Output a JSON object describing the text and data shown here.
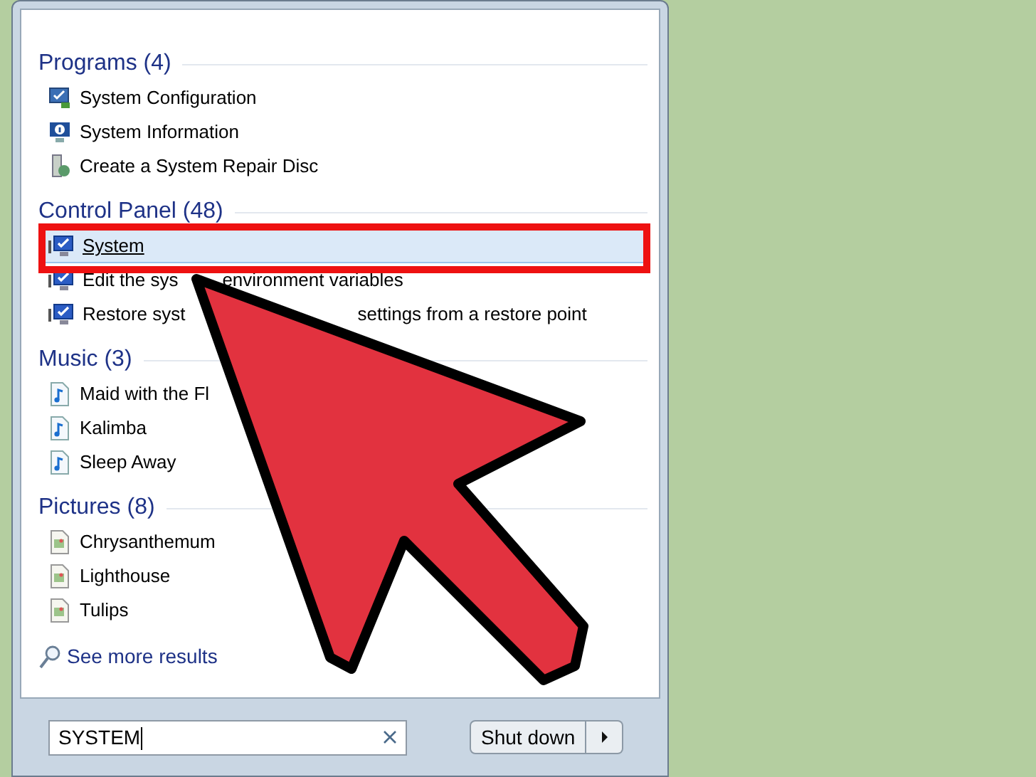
{
  "groups": [
    {
      "heading": "Programs (4)",
      "items": [
        {
          "kind": "config",
          "parts": [
            "System Configuration"
          ],
          "selected": false
        },
        {
          "kind": "info",
          "parts": [
            "System Information"
          ],
          "selected": false
        },
        {
          "kind": "repair",
          "parts": [
            "Create a System Repair Disc"
          ],
          "selected": false
        }
      ]
    },
    {
      "heading": "Control Panel (48)",
      "items": [
        {
          "kind": "control",
          "parts": [
            "System"
          ],
          "selected": true
        },
        {
          "kind": "control",
          "parts": [
            "Edit the sys",
            "environment variables"
          ],
          "selected": false
        },
        {
          "kind": "control",
          "parts": [
            "Restore syst",
            "settings from a restore point"
          ],
          "selected": false
        }
      ]
    },
    {
      "heading": "Music (3)",
      "items": [
        {
          "kind": "music",
          "parts": [
            "Maid with the Fl"
          ],
          "selected": false
        },
        {
          "kind": "music",
          "parts": [
            "Kalimba"
          ],
          "selected": false
        },
        {
          "kind": "music",
          "parts": [
            "Sleep Away"
          ],
          "selected": false
        }
      ]
    },
    {
      "heading": "Pictures (8)",
      "items": [
        {
          "kind": "picture",
          "parts": [
            "Chrysanthemum"
          ],
          "selected": false
        },
        {
          "kind": "picture",
          "parts": [
            "Lighthouse"
          ],
          "selected": false
        },
        {
          "kind": "picture",
          "parts": [
            "Tulips"
          ],
          "selected": false
        }
      ]
    }
  ],
  "see_more": "See more results",
  "search": {
    "value": "SYSTEM"
  },
  "shutdown": "Shut down"
}
